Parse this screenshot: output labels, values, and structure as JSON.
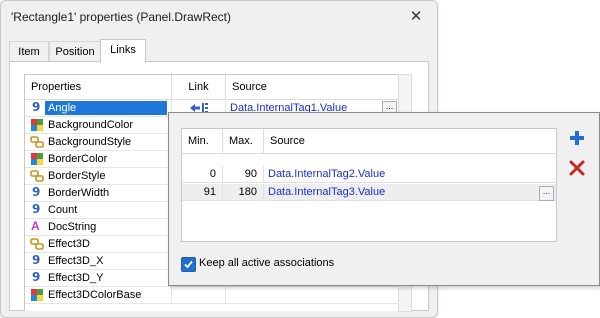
{
  "dialog": {
    "title": "'Rectangle1' properties (Panel.DrawRect)",
    "close_glyph": "✕"
  },
  "tabs": [
    {
      "label": "Item",
      "active": false
    },
    {
      "label": "Position",
      "active": false
    },
    {
      "label": "Links",
      "active": true
    }
  ],
  "properties_grid": {
    "headers": {
      "property": "Properties",
      "link": "Link",
      "source": "Source"
    },
    "rows": [
      {
        "name": "Angle",
        "icon": "numeric-9-icon",
        "selected": true,
        "link_icon": "link-arrow-icon",
        "source": "Data.InternalTag1.Value"
      },
      {
        "name": "BackgroundColor",
        "icon": "color-palette-icon"
      },
      {
        "name": "BackgroundStyle",
        "icon": "style-chain-icon"
      },
      {
        "name": "BorderColor",
        "icon": "color-palette-icon"
      },
      {
        "name": "BorderStyle",
        "icon": "style-chain-icon"
      },
      {
        "name": "BorderWidth",
        "icon": "numeric-9-icon"
      },
      {
        "name": "Count",
        "icon": "numeric-9-icon"
      },
      {
        "name": "DocString",
        "icon": "text-a-icon"
      },
      {
        "name": "Effect3D",
        "icon": "style-chain-icon"
      },
      {
        "name": "Effect3D_X",
        "icon": "numeric-9-icon"
      },
      {
        "name": "Effect3D_Y",
        "icon": "numeric-9-icon"
      },
      {
        "name": "Effect3DColorBase",
        "icon": "color-palette-icon"
      }
    ],
    "glyph_nine": "9",
    "glyph_a": "A",
    "ellipsis": "..."
  },
  "associations": {
    "headers": {
      "min": "Min.",
      "max": "Max.",
      "source": "Source"
    },
    "rows": [
      {
        "min": "0",
        "max": "90",
        "source": "Data.InternalTag2.Value"
      },
      {
        "min": "91",
        "max": "180",
        "source": "Data.InternalTag3.Value"
      }
    ],
    "keep_all_label": "Keep all active associations",
    "keep_all_checked": true,
    "add_icon": "plus-icon",
    "delete_icon": "delete-x-icon"
  },
  "colors": {
    "selection": "#1e78d7",
    "link_text": "#1c2fc8",
    "nine_icon": "#2f62c2",
    "add_button": "#1f6fd0",
    "delete_button": "#c62828"
  }
}
